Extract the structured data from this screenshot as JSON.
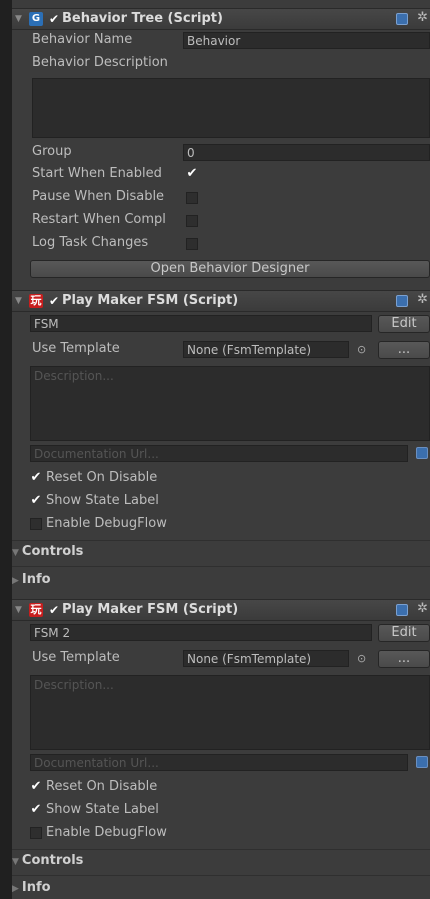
{
  "behavior_tree": {
    "title": "Behavior Tree (Script)",
    "component_icon": "G",
    "behavior_name_label": "Behavior Name",
    "behavior_name_value": "Behavior",
    "behavior_description_label": "Behavior Description",
    "group_label": "Group",
    "group_value": "0",
    "start_when_enabled_label": "Start When Enabled",
    "pause_when_disabled_label": "Pause When Disable",
    "restart_when_complete_label": "Restart When Compl",
    "log_task_changes_label": "Log Task Changes",
    "open_designer_button": "Open Behavior Designer",
    "start_when_enabled_checked": true,
    "pause_when_disabled_checked": false,
    "restart_when_complete_checked": false,
    "log_task_changes_checked": false
  },
  "fsm1": {
    "title": "Play Maker FSM (Script)",
    "component_icon": "玩",
    "fsm_name_value": "FSM",
    "edit_button": "Edit",
    "use_template_label": "Use Template",
    "template_value": "None (FsmTemplate)",
    "browse_button": "...",
    "description_placeholder": "Description...",
    "doc_url_placeholder": "Documentation Url...",
    "reset_on_disable_label": "Reset On Disable",
    "show_state_label_label": "Show State Label",
    "enable_debugflow_label": "Enable DebugFlow",
    "reset_on_disable_checked": true,
    "show_state_label_checked": true,
    "enable_debugflow_checked": false,
    "controls_label": "Controls",
    "info_label": "Info"
  },
  "fsm2": {
    "title": "Play Maker FSM (Script)",
    "component_icon": "玩",
    "fsm_name_value": "FSM 2",
    "edit_button": "Edit",
    "use_template_label": "Use Template",
    "template_value": "None (FsmTemplate)",
    "browse_button": "...",
    "description_placeholder": "Description...",
    "doc_url_placeholder": "Documentation Url...",
    "reset_on_disable_label": "Reset On Disable",
    "show_state_label_label": "Show State Label",
    "enable_debugflow_label": "Enable DebugFlow",
    "reset_on_disable_checked": true,
    "show_state_label_checked": true,
    "enable_debugflow_checked": false,
    "controls_label": "Controls",
    "info_label": "Info"
  },
  "glyphs": {
    "foldout_open": "▼",
    "foldout_closed": "▶",
    "check": "✔",
    "gear": "✲",
    "target": "⊙"
  },
  "colors": {
    "panel_bg": "#3c3c3c",
    "field_bg": "#2c2c2c",
    "help_icon": "#3b6fae",
    "playmaker_icon": "#c81e1e",
    "behavior_icon": "#2b6fb6"
  }
}
